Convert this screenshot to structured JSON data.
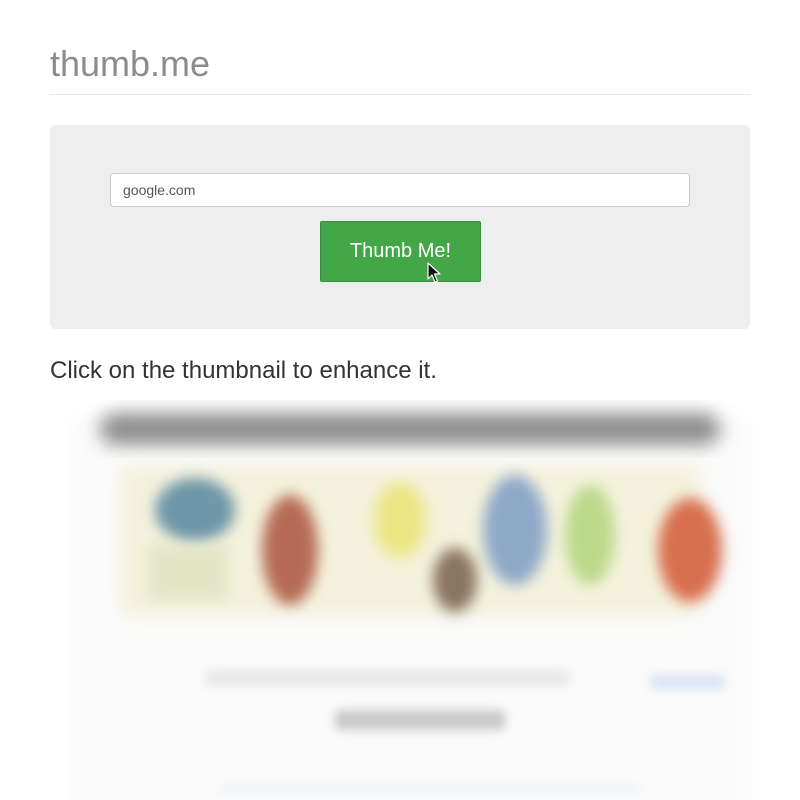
{
  "header": {
    "brand": "thumb.me"
  },
  "form": {
    "url_value": "google.com",
    "submit_label": "Thumb Me!"
  },
  "instruction": "Click on the thumbnail to enhance it.",
  "colors": {
    "accent_button": "#43a647",
    "panel_background": "#eeeeee",
    "brand_text": "#8c8c8c"
  }
}
